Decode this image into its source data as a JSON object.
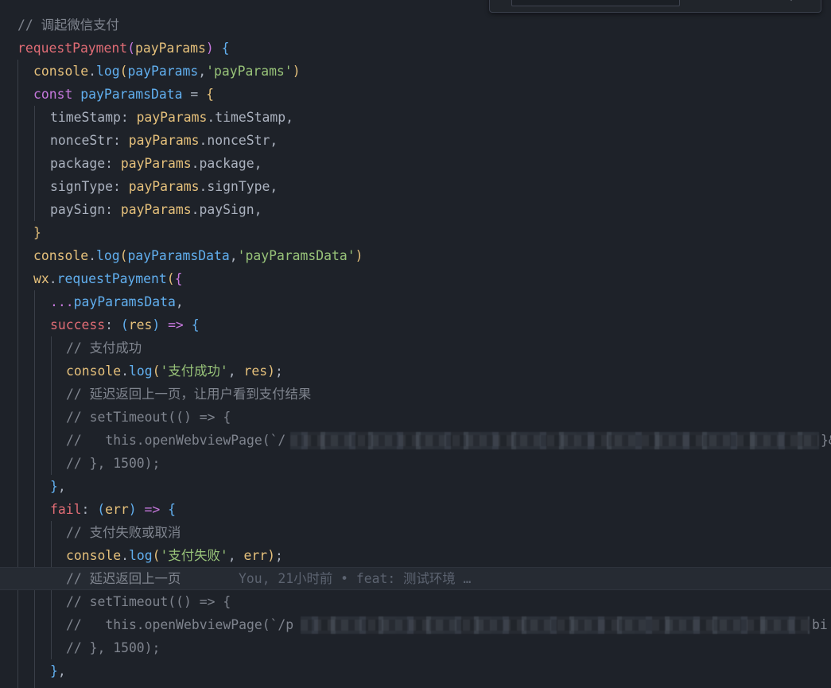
{
  "editor": {
    "blame": "You, 21小时前 • feat: 测试环境 …"
  },
  "lines": {
    "l1_comment": "// 调起微信支付",
    "l2_name": "requestPayment",
    "l2_param": "payParams",
    "l3_obj": "console",
    "l3_method": "log",
    "l3_arg": "payParams",
    "l3_str": "'payParams'",
    "l4_kw": "const",
    "l4_var": "payParamsData",
    "k_timeStamp": "timeStamp",
    "k_nonceStr": "nonceStr",
    "k_package": "package",
    "k_signType": "signType",
    "k_paySign": "paySign",
    "v_obj": "payParams",
    "v_timeStamp": "timeStamp",
    "v_nonceStr": "nonceStr",
    "v_package": "package",
    "v_signType": "signType",
    "v_paySign": "paySign",
    "l11_arg": "payParamsData",
    "l11_str": "'payParamsData'",
    "l12_obj": "wx",
    "l12_method": "requestPayment",
    "l13_spread": "...",
    "l13_var": "payParamsData",
    "l14_key": "success",
    "l14_param": "res",
    "l15_comment": "// 支付成功",
    "l16_str": "'支付成功'",
    "l16_arg": "res",
    "l17_comment": "// 延迟返回上一页，让用户看到支付结果",
    "l18_comment": "// setTimeout(() => {",
    "l19_comment": "//   this.openWebviewPage(`/",
    "l19_tail": "}&",
    "l20_comment": "// }, 1500);",
    "l22_key": "fail",
    "l22_param": "err",
    "l23_comment": "// 支付失败或取消",
    "l24_str": "'支付失败'",
    "l24_arg": "err",
    "l25_comment": "// 延迟返回上一页",
    "l26_comment": "// setTimeout(() => {",
    "l27_comment": "//   this.openWebviewPage(`/p",
    "l27_tail": "bi",
    "l28_comment": "// }, 1500);"
  },
  "colors": {
    "background": "#1e2229",
    "comment": "#7f848e",
    "function": "#e06c75",
    "string": "#98c379",
    "keyword": "#c678dd",
    "variable": "#61afef",
    "object": "#e5c07b"
  }
}
